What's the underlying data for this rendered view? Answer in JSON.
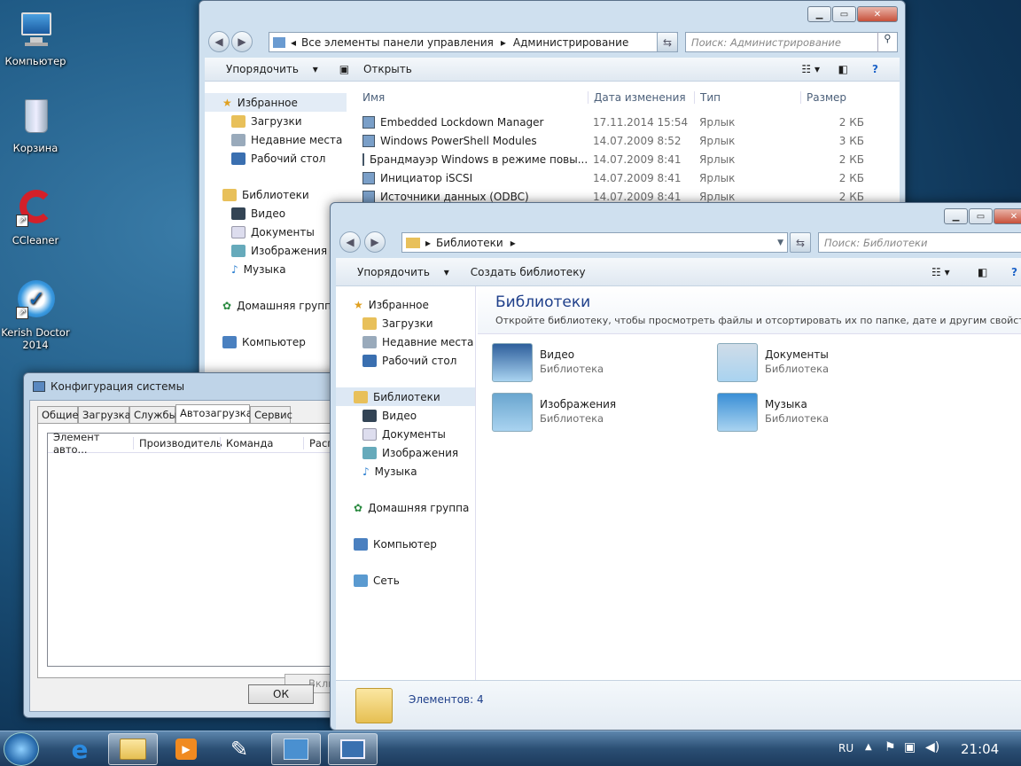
{
  "desktop": {
    "icons": [
      {
        "name": "computer",
        "label": "Компьютер"
      },
      {
        "name": "recycle",
        "label": "Корзина"
      },
      {
        "name": "ccleaner",
        "label": "CCleaner"
      },
      {
        "name": "kerish",
        "label": "Kerish Doctor 2014"
      }
    ]
  },
  "admin_window": {
    "address": "Все элементы панели управления",
    "address2": "Администрирование",
    "search_placeholder": "Поиск: Администрирование",
    "organize": "Упорядочить",
    "open": "Открыть",
    "nav": {
      "favorites": "Избранное",
      "downloads": "Загрузки",
      "recent": "Недавние места",
      "desktop": "Рабочий стол",
      "libraries": "Библиотеки",
      "video": "Видео",
      "docs": "Документы",
      "images": "Изображения",
      "music": "Музыка",
      "homegroup": "Домашняя группа",
      "computer": "Компьютер"
    },
    "columns": {
      "name": "Имя",
      "date": "Дата изменения",
      "type": "Тип",
      "size": "Размер"
    },
    "files": [
      {
        "name": "Embedded Lockdown Manager",
        "date": "17.11.2014 15:54",
        "type": "Ярлык",
        "size": "2 КБ"
      },
      {
        "name": "Windows PowerShell Modules",
        "date": "14.07.2009 8:52",
        "type": "Ярлык",
        "size": "3 КБ"
      },
      {
        "name": "Брандмауэр Windows в режиме повы...",
        "date": "14.07.2009 8:41",
        "type": "Ярлык",
        "size": "2 КБ"
      },
      {
        "name": "Инициатор iSCSI",
        "date": "14.07.2009 8:41",
        "type": "Ярлык",
        "size": "2 КБ"
      },
      {
        "name": "Источники данных (ODBC)",
        "date": "14.07.2009 8:41",
        "type": "Ярлык",
        "size": "2 КБ"
      }
    ]
  },
  "msconfig": {
    "title": "Конфигурация системы",
    "tabs": [
      "Общие",
      "Загрузка",
      "Службы",
      "Автозагрузка",
      "Сервис"
    ],
    "columns": [
      "Элемент авто...",
      "Производитель",
      "Команда",
      "Расп"
    ],
    "enable_btn": "Вклю",
    "ok": "ОК"
  },
  "lib_window": {
    "address": "Библиотеки",
    "search_placeholder": "Поиск: Библиотеки",
    "organize": "Упорядочить",
    "create": "Создать библиотеку",
    "heading": "Библиотеки",
    "subheading": "Откройте библиотеку, чтобы просмотреть файлы и отсортировать их по папке, дате и другим свойствам.",
    "nav": {
      "favorites": "Избранное",
      "downloads": "Загрузки",
      "recent": "Недавние места",
      "desktop": "Рабочий стол",
      "libraries": "Библиотеки",
      "video": "Видео",
      "docs": "Документы",
      "images": "Изображения",
      "music": "Музыка",
      "homegroup": "Домашняя группа",
      "computer": "Компьютер",
      "network": "Сеть"
    },
    "items": [
      {
        "name": "Видео",
        "sub": "Библиотека"
      },
      {
        "name": "Документы",
        "sub": "Библиотека"
      },
      {
        "name": "Изображения",
        "sub": "Библиотека"
      },
      {
        "name": "Музыка",
        "sub": "Библиотека"
      }
    ],
    "status": "Элементов: 4"
  },
  "taskbar": {
    "lang": "RU",
    "time": "21:04"
  }
}
